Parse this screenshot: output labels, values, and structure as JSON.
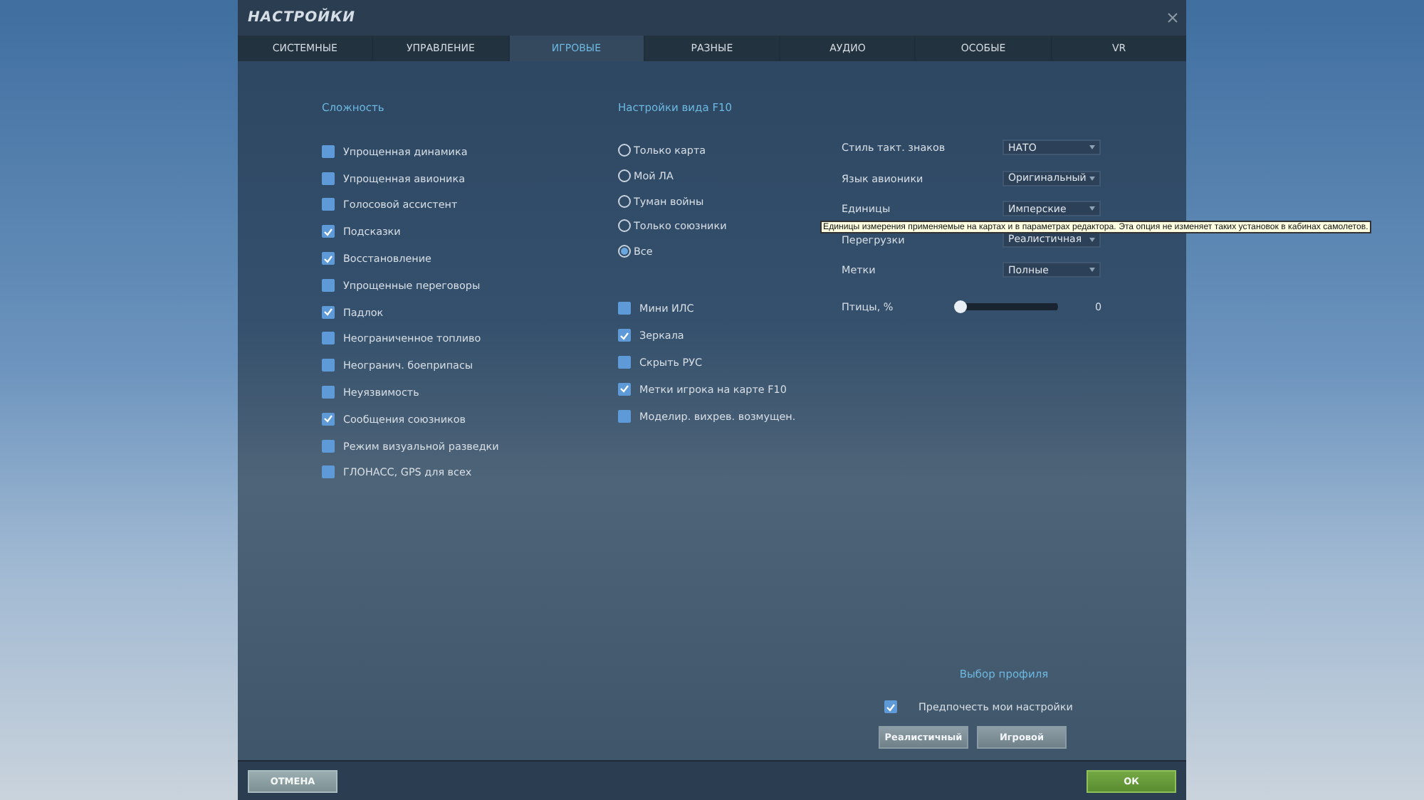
{
  "window": {
    "title": "НАСТРОЙКИ"
  },
  "tabs": [
    {
      "label": "СИСТЕМНЫЕ",
      "selected": false
    },
    {
      "label": "УПРАВЛЕНИЕ",
      "selected": false
    },
    {
      "label": "ИГРОВЫЕ",
      "selected": true
    },
    {
      "label": "РАЗНЫЕ",
      "selected": false
    },
    {
      "label": "АУДИО",
      "selected": false
    },
    {
      "label": "ОСОБЫЕ",
      "selected": false
    },
    {
      "label": "VR",
      "selected": false
    }
  ],
  "difficulty": {
    "title": "Сложность",
    "items": [
      {
        "label": "Упрощенная динамика",
        "checked": false
      },
      {
        "label": "Упрощенная авионика",
        "checked": false
      },
      {
        "label": "Голосовой ассистент",
        "checked": false
      },
      {
        "label": "Подсказки",
        "checked": true
      },
      {
        "label": "Восстановление",
        "checked": true
      },
      {
        "label": "Упрощенные переговоры",
        "checked": false
      },
      {
        "label": "Падлок",
        "checked": true
      },
      {
        "label": "Неограниченное топливо",
        "checked": false
      },
      {
        "label": "Неогранич. боеприпасы",
        "checked": false
      },
      {
        "label": "Неуязвимость",
        "checked": false
      },
      {
        "label": "Сообщения союзников",
        "checked": true
      },
      {
        "label": "Режим визуальной разведки",
        "checked": false
      },
      {
        "label": "ГЛОНАСС, GPS для всех",
        "checked": false
      }
    ]
  },
  "f10": {
    "title": "Настройки вида F10",
    "views": [
      {
        "label": "Только карта",
        "selected": false
      },
      {
        "label": "Мой ЛА",
        "selected": false
      },
      {
        "label": "Туман войны",
        "selected": false
      },
      {
        "label": "Только союзники",
        "selected": false
      },
      {
        "label": "Все",
        "selected": true
      }
    ],
    "options": [
      {
        "label": "Мини ИЛС",
        "checked": false
      },
      {
        "label": "Зеркала",
        "checked": true
      },
      {
        "label": "Скрыть РУС",
        "checked": false
      },
      {
        "label": "Метки игрока на карте F10",
        "checked": true
      },
      {
        "label": "Моделир. вихрев. возмущен.",
        "checked": false
      }
    ]
  },
  "settings": [
    {
      "kind": "select",
      "label": "Стиль такт. знаков",
      "value": "НАТО"
    },
    {
      "kind": "select",
      "label": "Язык авионики",
      "value": "Оригинальный"
    },
    {
      "kind": "select",
      "label": "Единицы",
      "value": "Имперские"
    },
    {
      "kind": "select",
      "label": "Перегрузки",
      "value": "Реалистичная"
    },
    {
      "kind": "select",
      "label": "Метки",
      "value": "Полные"
    },
    {
      "kind": "slider",
      "label": "Птицы, %",
      "level": 0,
      "reading": "0"
    }
  ],
  "tooltip": "Единицы измерения применяемые на картах и в параметрах редактора. Эта опция не изменяет таких установок в кабинах самолетов.",
  "profile": {
    "title": "Выбор профиля",
    "prefer": {
      "label": "Предпочесть мои настройки",
      "checked": true
    },
    "buttons": [
      "Реалистичный",
      "Игровой"
    ]
  },
  "footer": [
    {
      "kind": "cancel",
      "label": "ОТМЕНА"
    },
    {
      "kind": "ok",
      "label": "ОК"
    }
  ]
}
